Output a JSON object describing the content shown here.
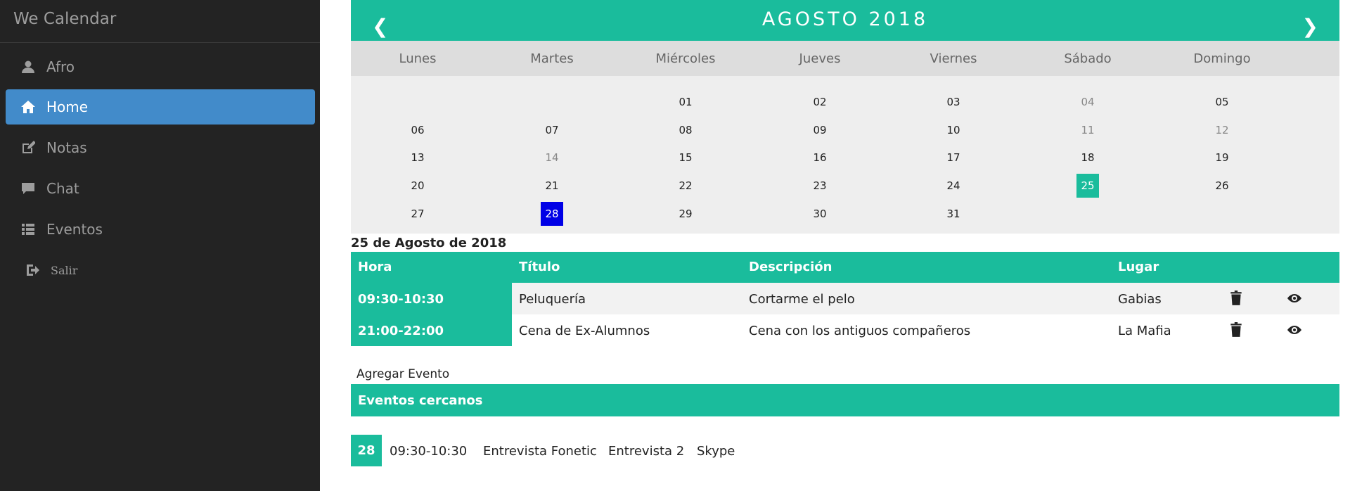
{
  "app": {
    "title": "We Calendar"
  },
  "sidebar": {
    "items": [
      {
        "label": "Afro",
        "icon": "user-icon"
      },
      {
        "label": "Home",
        "icon": "home-icon",
        "active": true
      },
      {
        "label": "Notas",
        "icon": "edit-icon"
      },
      {
        "label": "Chat",
        "icon": "comment-icon"
      },
      {
        "label": "Eventos",
        "icon": "list-icon"
      },
      {
        "label": "Salir",
        "icon": "logout-icon"
      }
    ]
  },
  "calendar": {
    "month_title": "AGOSTO 2018",
    "prev": "❮",
    "next": "❯",
    "weekdays": [
      "Lunes",
      "Martes",
      "Miércoles",
      "Jueves",
      "Viernes",
      "Sábado",
      "Domingo"
    ],
    "weeks": [
      [
        "",
        "",
        "01",
        "02",
        "03",
        "04",
        "05"
      ],
      [
        "06",
        "07",
        "08",
        "09",
        "10",
        "11",
        "12"
      ],
      [
        "13",
        "14",
        "15",
        "16",
        "17",
        "18",
        "19"
      ],
      [
        "20",
        "21",
        "22",
        "23",
        "24",
        "25",
        "26"
      ],
      [
        "27",
        "28",
        "29",
        "30",
        "31",
        "",
        ""
      ]
    ],
    "muted_days": [
      "04",
      "11",
      "12",
      "14"
    ],
    "selected_day": "25",
    "today_day": "28",
    "colors": {
      "accent": "#1abc9c",
      "today": "#0000e6",
      "sidebar": "#232323",
      "active_nav": "#428bca"
    }
  },
  "day_view": {
    "heading": "25 de Agosto de 2018",
    "columns": {
      "hora": "Hora",
      "titulo": "Título",
      "descripcion": "Descripción",
      "lugar": "Lugar"
    },
    "events": [
      {
        "hora": "09:30-10:30",
        "titulo": "Peluquería",
        "descripcion": "Cortarme el pelo",
        "lugar": "Gabias"
      },
      {
        "hora": "21:00-22:00",
        "titulo": "Cena de Ex-Alumnos",
        "descripcion": "Cena con los antiguos compañeros",
        "lugar": "La Mafia"
      }
    ],
    "add_label": "Agregar Evento"
  },
  "nearby": {
    "heading": "Eventos cercanos",
    "events": [
      {
        "day": "28",
        "hora": "09:30-10:30",
        "titulo": "Entrevista Fonetic",
        "descripcion": "Entrevista 2",
        "lugar": "Skype"
      }
    ]
  }
}
